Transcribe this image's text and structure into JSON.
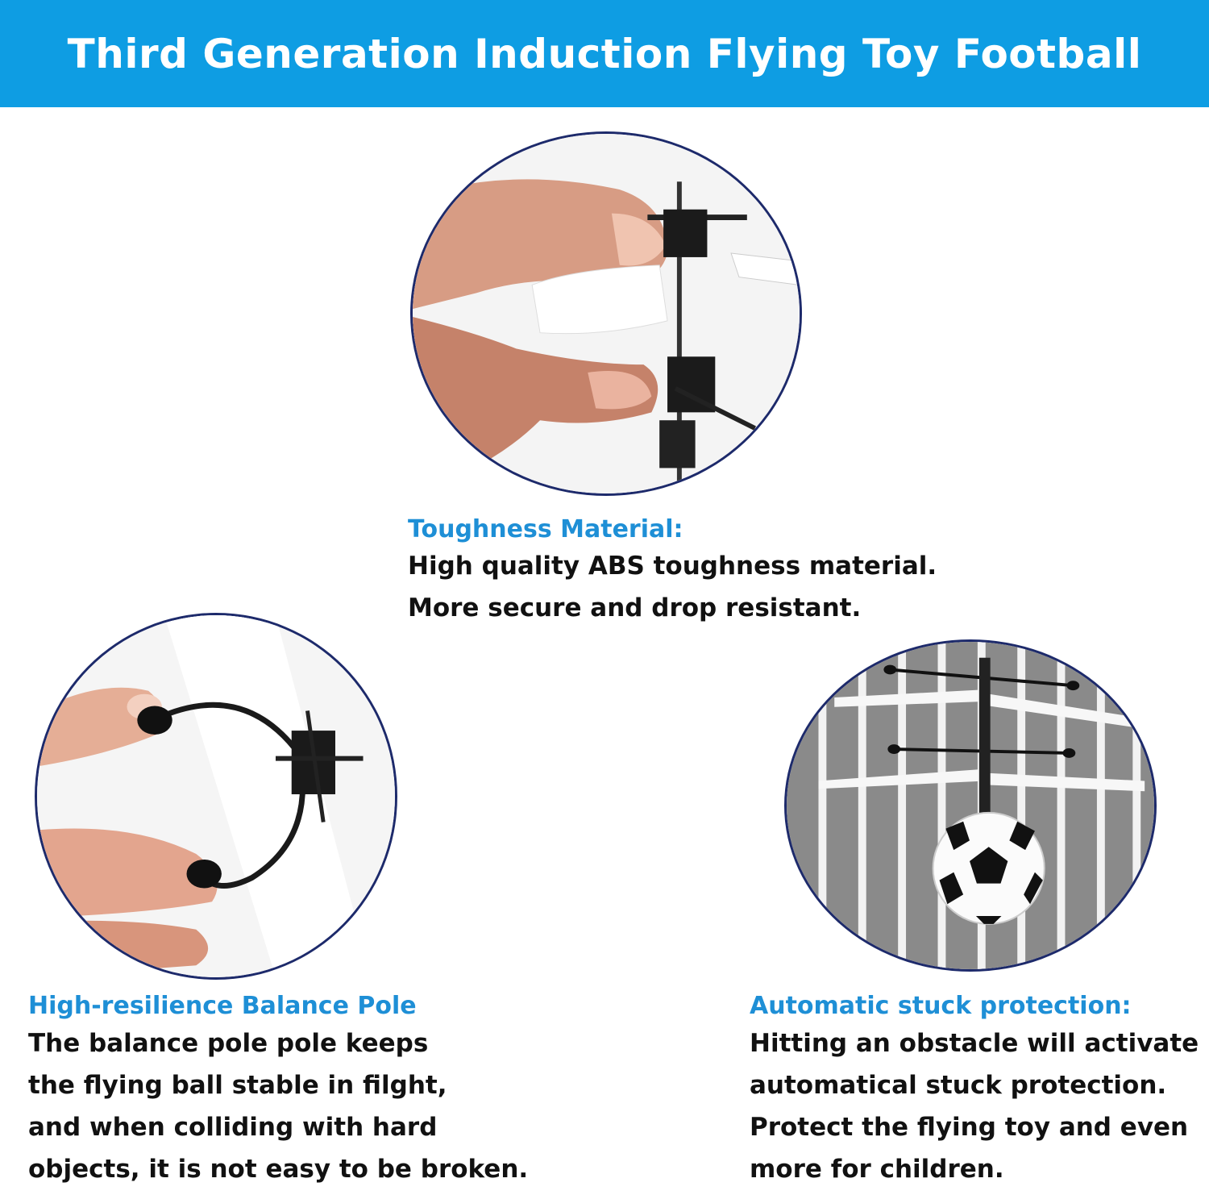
{
  "banner": {
    "title": "Third Generation Induction Flying Toy Football"
  },
  "features": {
    "material": {
      "title": "Toughness Material:",
      "lines": [
        "High quality ABS toughness material.",
        "More secure and drop resistant."
      ]
    },
    "balance": {
      "title": "High-resilience Balance Pole",
      "lines": [
        "The balance pole pole keeps",
        "the flying ball stable in filght,",
        "and when colliding with hard",
        "objects, it is not easy to be broken."
      ]
    },
    "protection": {
      "title": "Automatic stuck protection:",
      "lines": [
        "Hitting an obstacle will activate",
        "automatical stuck protection.",
        "Protect the flying toy and even",
        "more for children."
      ]
    }
  },
  "colors": {
    "banner": "#0e9de3",
    "accent_title": "#1e8fd6",
    "circle_border": "#1d2a6b"
  }
}
